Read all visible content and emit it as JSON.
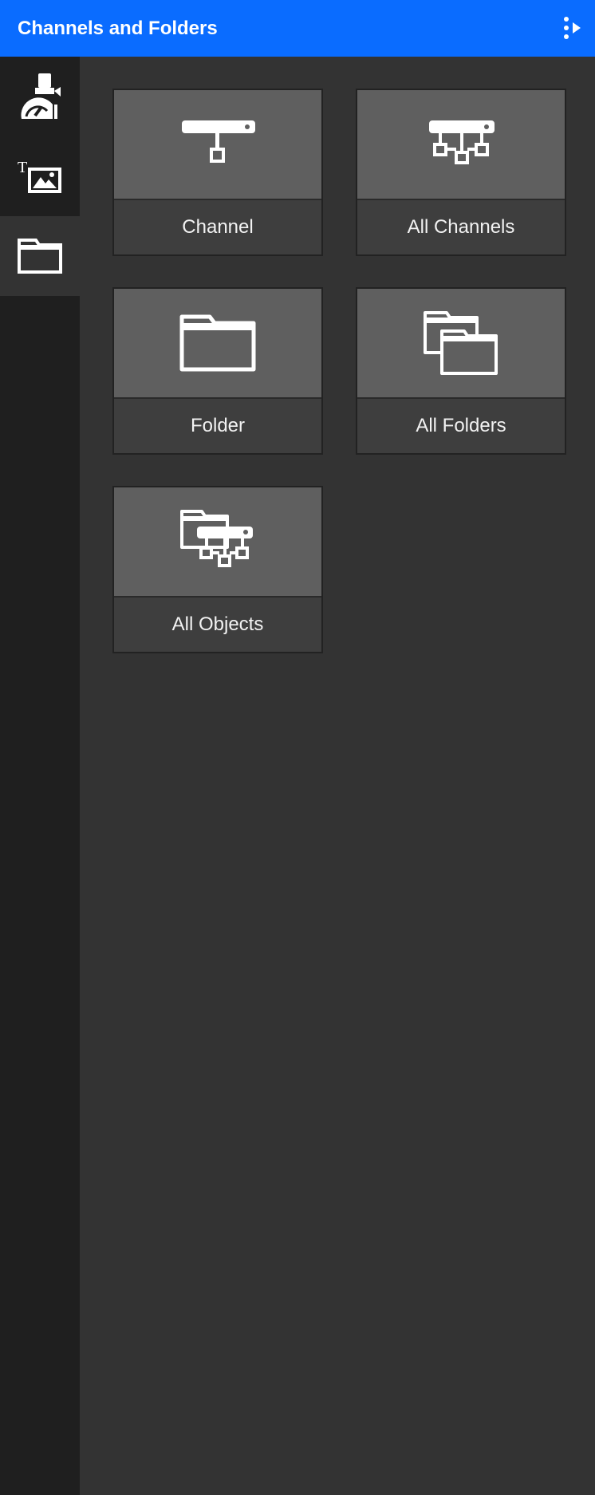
{
  "header": {
    "title": "Channels and Folders",
    "menu_icon": "more-vertical-play-icon",
    "background_color": "#0a6cff"
  },
  "sidebar": {
    "items": [
      {
        "icon": "painter-dashboard-icon",
        "active": false
      },
      {
        "icon": "text-image-icon",
        "active": false
      },
      {
        "icon": "folder-icon",
        "active": true
      }
    ]
  },
  "tiles": [
    {
      "label": "Channel",
      "icon": "channel-icon"
    },
    {
      "label": "All Channels",
      "icon": "all-channels-icon"
    },
    {
      "label": "Folder",
      "icon": "folder-icon"
    },
    {
      "label": "All Folders",
      "icon": "all-folders-icon"
    },
    {
      "label": "All Objects",
      "icon": "all-objects-icon"
    }
  ],
  "colors": {
    "background": "#333333",
    "sidebar": "#1f1f1f",
    "tile_top": "#5f5f5f",
    "tile_label": "#3e3e3e",
    "text": "#f2f2f2"
  }
}
